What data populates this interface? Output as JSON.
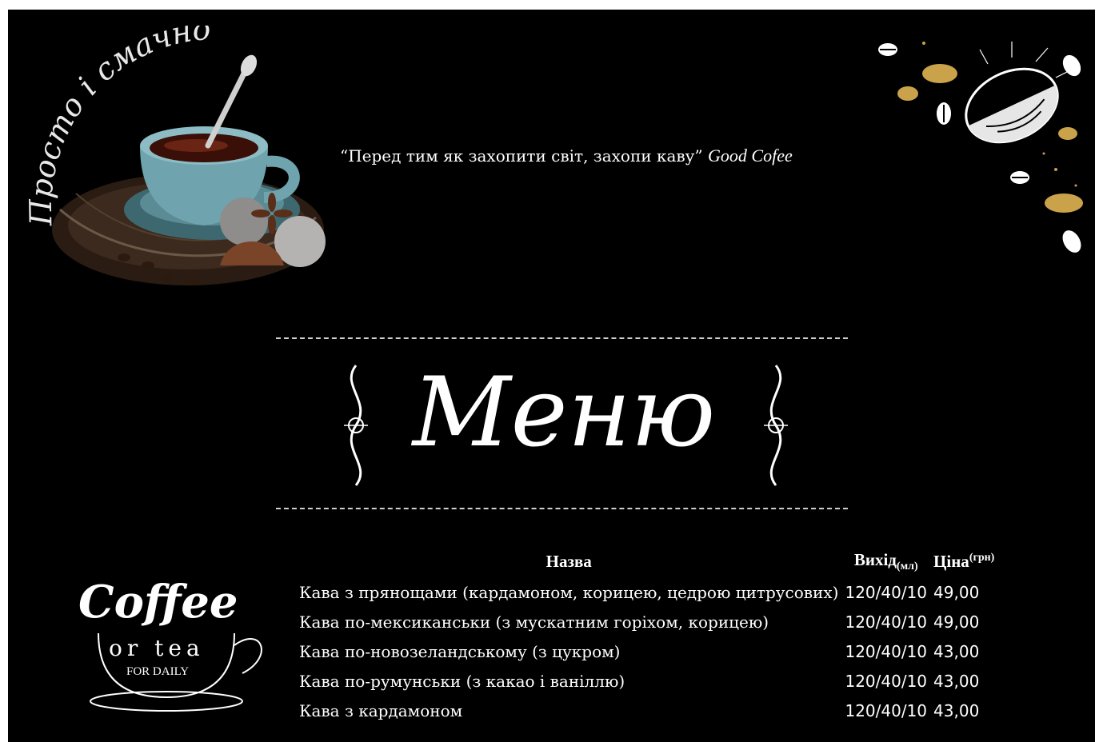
{
  "header": {
    "quote_text": "“Перед тим як захопити світ, захопи каву”",
    "quote_brand": "Good Cofee"
  },
  "decor": {
    "top_left_script": "Просто і смачно",
    "top_left_icon": "coffee-cup-illustration",
    "top_right_icon": "coffee-beans-illustration",
    "ornament_icon": "scroll-ornament"
  },
  "title": "Меню",
  "logo": {
    "line1": "Coffee",
    "line2": "or tea",
    "line3": "FOR DAILY"
  },
  "table": {
    "headers": {
      "name": "Назва",
      "output": "Вихід",
      "output_unit": "(мл)",
      "price": "Ціна",
      "price_unit": "(грн)"
    },
    "rows": [
      {
        "name": "Кава з прянощами (кардамоном, корицею, цедрою цитрусових)",
        "output": "120/40/10",
        "price": "49,00"
      },
      {
        "name": "Кава по-мексиканськи (з мускатним горіхом, корицею)",
        "output": "120/40/10",
        "price": "49,00"
      },
      {
        "name": "Кава по-новозеландському (з цукром)",
        "output": "120/40/10",
        "price": "43,00"
      },
      {
        "name": "Кава по-румунськи (з какао і ваніллю)",
        "output": "120/40/10",
        "price": "43,00"
      },
      {
        "name": "Кава з кардамоном",
        "output": "120/40/10",
        "price": "43,00"
      }
    ]
  },
  "colors": {
    "background": "#000000",
    "text": "#ffffff",
    "cup": "#6fa3ad",
    "gold": "#c9a24a"
  }
}
